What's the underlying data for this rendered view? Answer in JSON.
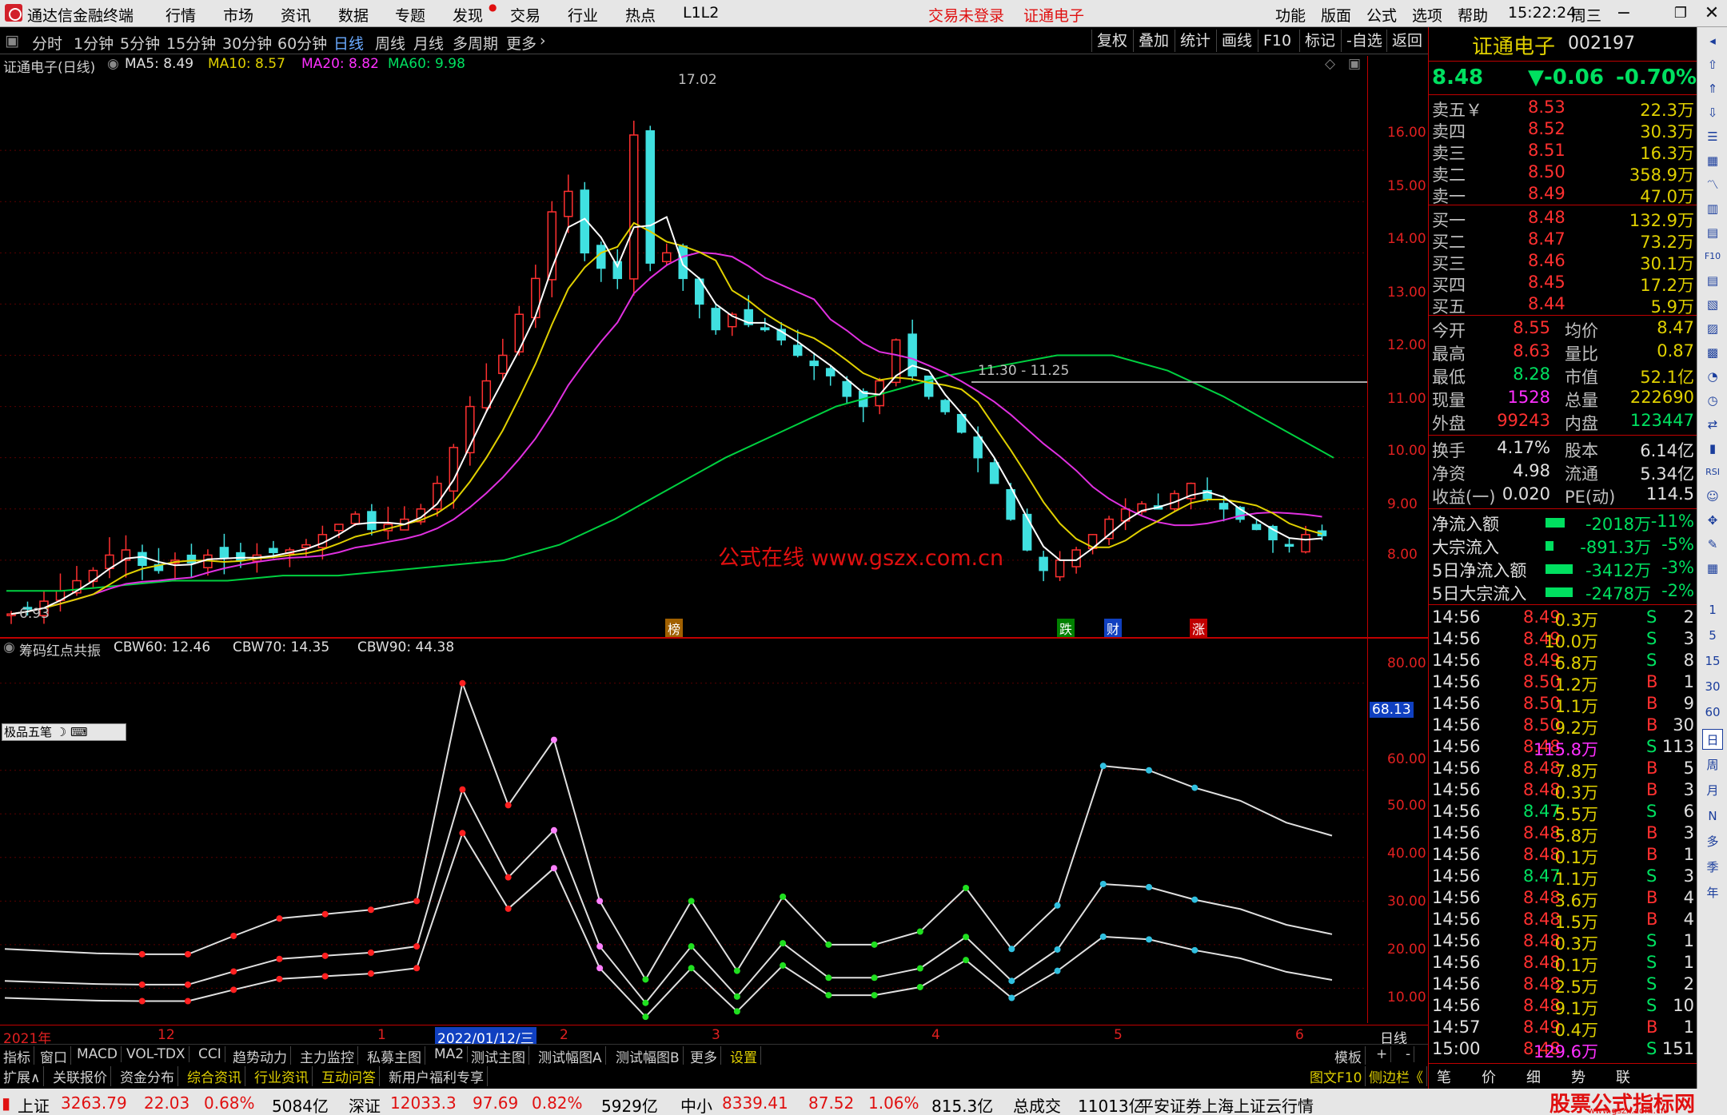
{
  "app": {
    "title": "通达信金融终端",
    "menus": [
      "行情",
      "市场",
      "资讯",
      "数据",
      "专题",
      "发现",
      "交易",
      "行业",
      "热点",
      "L1L2"
    ],
    "trade_status": "交易未登录",
    "stock_name_top": "证通电子",
    "right_menus": [
      "功能",
      "版面",
      "公式",
      "选项",
      "帮助"
    ],
    "time": "15:22:24",
    "weekday": "周三"
  },
  "timeframes": [
    "分时",
    "1分钟",
    "5分钟",
    "15分钟",
    "30分钟",
    "60分钟",
    "日线",
    "周线",
    "月线",
    "多周期",
    "更多"
  ],
  "active_timeframe": "日线",
  "toolbar_btns": [
    "复权",
    "叠加",
    "统计",
    "画线",
    "F10",
    "标记",
    "-自选",
    "返回"
  ],
  "chart_title": {
    "stock": "证通电子(日线)",
    "ma5": "MA5: 8.49",
    "ma10": "MA10: 8.57",
    "ma20": "MA20: 8.82",
    "ma60": "MA60: 9.98"
  },
  "annotations": {
    "high": "17.02",
    "low": "6.93",
    "range": "11.30 - 11.25",
    "watermark": "公式在线 www.gszx.com.cn",
    "event_bang": "榜",
    "event_die": "跌",
    "event_cai": "财",
    "event_zhang": "涨"
  },
  "y_axis_main": [
    "16.00",
    "15.00",
    "14.00",
    "13.00",
    "12.00",
    "11.00",
    "10.00",
    "9.00",
    "8.00"
  ],
  "sub_title": {
    "name": "筹码红点共振",
    "cbw60": "CBW60: 12.46",
    "cbw70": "CBW70: 14.35",
    "cbw90": "CBW90: 44.38"
  },
  "y_axis_sub": [
    "80.00",
    "60.00",
    "50.00",
    "40.00",
    "30.00",
    "20.00",
    "10.00"
  ],
  "sub_marker": "68.13",
  "ime_label": "极品五笔",
  "x_axis": {
    "labels": [
      "2021年",
      "12",
      "1",
      "2022/01/12/三",
      "2",
      "3",
      "4",
      "5",
      "6"
    ],
    "corner": "日线"
  },
  "tabs_row1": [
    "指标",
    "窗口",
    "MACD",
    "VOL-TDX",
    "CCI",
    "趋势动力",
    "主力监控",
    "私募主图",
    "MA2",
    "测试主图",
    "测试幅图A",
    "测试幅图B",
    "更多",
    "设置"
  ],
  "tabs_row1_right": [
    "模板",
    "+",
    "-"
  ],
  "tabs_row2": [
    "扩展∧",
    "关联报价",
    "资金分布",
    "综合资讯",
    "行业资讯",
    "互动问答",
    "新用户福利专享"
  ],
  "tabs_row2_right": [
    "图文F10",
    "侧边栏《"
  ],
  "right_panel": {
    "name": "证通电子",
    "code": "002197",
    "price": "8.48",
    "change": "▼-0.06",
    "pct": "-0.70%",
    "asks": [
      {
        "l": "卖五￥",
        "p": "8.53",
        "v": "22.3万"
      },
      {
        "l": "卖四",
        "p": "8.52",
        "v": "30.3万"
      },
      {
        "l": "卖三",
        "p": "8.51",
        "v": "16.3万"
      },
      {
        "l": "卖二",
        "p": "8.50",
        "v": "358.9万"
      },
      {
        "l": "卖一",
        "p": "8.49",
        "v": "47.0万"
      }
    ],
    "bids": [
      {
        "l": "买一",
        "p": "8.48",
        "v": "132.9万"
      },
      {
        "l": "买二",
        "p": "8.47",
        "v": "73.2万"
      },
      {
        "l": "买三",
        "p": "8.46",
        "v": "30.1万"
      },
      {
        "l": "买四",
        "p": "8.45",
        "v": "17.2万"
      },
      {
        "l": "买五",
        "p": "8.44",
        "v": "5.9万"
      }
    ],
    "stats1": [
      [
        "今开",
        "8.55",
        "均价",
        "8.47"
      ],
      [
        "最高",
        "8.63",
        "量比",
        "0.87"
      ],
      [
        "最低",
        "8.28",
        "市值",
        "52.1亿"
      ],
      [
        "现量",
        "1528",
        "总量",
        "222690"
      ],
      [
        "外盘",
        "99243",
        "内盘",
        "123447"
      ]
    ],
    "stats2": [
      [
        "换手",
        "4.17%",
        "股本",
        "6.14亿"
      ],
      [
        "净资",
        "4.98",
        "流通",
        "5.34亿"
      ],
      [
        "收益(一)",
        "0.020",
        "PE(动)",
        "114.5"
      ]
    ],
    "flows": [
      [
        "净流入额",
        "-2018万",
        "-11%"
      ],
      [
        "大宗流入",
        "-891.3万",
        "-5%"
      ],
      [
        "5日净流入额",
        "-3412万",
        "-3%"
      ],
      [
        "5日大宗流入",
        "-2478万",
        "-2%"
      ]
    ],
    "ticks": [
      [
        "14:56",
        "8.49",
        "0.3万",
        "S",
        "2"
      ],
      [
        "14:56",
        "8.49",
        "10.0万",
        "S",
        "3"
      ],
      [
        "14:56",
        "8.49",
        "6.8万",
        "S",
        "8"
      ],
      [
        "14:56",
        "8.50",
        "1.2万",
        "B",
        "1"
      ],
      [
        "14:56",
        "8.50",
        "1.1万",
        "B",
        "9"
      ],
      [
        "14:56",
        "8.50",
        "9.2万",
        "B",
        "30"
      ],
      [
        "14:56",
        "8.48",
        "115.8万",
        "S",
        "113"
      ],
      [
        "14:56",
        "8.48",
        "7.8万",
        "B",
        "5"
      ],
      [
        "14:56",
        "8.48",
        "0.3万",
        "B",
        "3"
      ],
      [
        "14:56",
        "8.47",
        "5.5万",
        "S",
        "6"
      ],
      [
        "14:56",
        "8.48",
        "5.8万",
        "B",
        "3"
      ],
      [
        "14:56",
        "8.48",
        "0.1万",
        "B",
        "1"
      ],
      [
        "14:56",
        "8.47",
        "1.1万",
        "S",
        "3"
      ],
      [
        "14:56",
        "8.48",
        "3.6万",
        "B",
        "4"
      ],
      [
        "14:56",
        "8.48",
        "1.5万",
        "B",
        "4"
      ],
      [
        "14:56",
        "8.48",
        "0.3万",
        "S",
        "1"
      ],
      [
        "14:56",
        "8.48",
        "0.1万",
        "S",
        "1"
      ],
      [
        "14:56",
        "8.48",
        "2.5万",
        "S",
        "2"
      ],
      [
        "14:56",
        "8.48",
        "9.1万",
        "S",
        "10"
      ],
      [
        "14:57",
        "8.49",
        "0.4万",
        "B",
        "1"
      ],
      [
        "15:00",
        "8.48",
        "129.6万",
        "S",
        "151"
      ]
    ],
    "bottom_tabs": [
      "笔",
      "价",
      "细",
      "势",
      "联"
    ]
  },
  "right_tools": [
    "F10",
    "RSI",
    "1",
    "5",
    "15",
    "30",
    "60",
    "日",
    "周",
    "月",
    "N",
    "多",
    "季",
    "年"
  ],
  "status": {
    "sh_name": "上证",
    "sh_idx": "3263.79",
    "sh_chg": "22.03",
    "sh_pct": "0.68%",
    "sh_amt": "5084亿",
    "sz_name": "深证",
    "sz_idx": "12033.3",
    "sz_chg": "97.69",
    "sz_pct": "0.82%",
    "sz_amt": "5929亿",
    "zx_name": "中小",
    "zx_idx": "8339.41",
    "zx_chg": "87.52",
    "zx_pct": "1.06%",
    "zx_amt": "815.3亿",
    "total_name": "总成交",
    "total_amt": "11013亿",
    "broker": "平安证券上海上证云行情",
    "brand": "股票公式指标网",
    "brand_url": "www.gszx.com.cn"
  },
  "chart_data": {
    "type": "candlestick",
    "y_range": [
      6.5,
      17.5
    ],
    "close_points": [
      6.95,
      7.05,
      7.2,
      7.4,
      7.6,
      7.8,
      8.1,
      8.2,
      7.9,
      7.8,
      8.0,
      7.95,
      8.1,
      8.05,
      8.0,
      8.1,
      8.15,
      8.2,
      8.3,
      8.5,
      8.7,
      8.9,
      8.6,
      8.7,
      8.8,
      9.0,
      9.5,
      10.2,
      11.0,
      11.5,
      12.0,
      12.8,
      13.5,
      14.8,
      15.2,
      14.0,
      13.7,
      13.5,
      16.3,
      13.8,
      14.0,
      13.5,
      13.0,
      12.5,
      12.8,
      12.6,
      12.5,
      12.3,
      12.0,
      11.8,
      11.6,
      11.2,
      11.0,
      11.5,
      12.3,
      11.6,
      11.2,
      10.9,
      10.5,
      10.0,
      9.5,
      8.8,
      8.2,
      7.8,
      8.0,
      8.2,
      8.5,
      8.8,
      9.0,
      9.1,
      9.0,
      9.3,
      9.5,
      9.2,
      9.0,
      8.8,
      8.6,
      8.4,
      8.3,
      8.5,
      8.48
    ],
    "ma60": [
      7.4,
      7.4,
      7.5,
      7.6,
      7.6,
      7.7,
      7.7,
      7.8,
      7.9,
      8.0,
      8.3,
      8.8,
      9.4,
      10.0,
      10.5,
      11.0,
      11.3,
      11.6,
      11.8,
      12.0,
      12.0,
      11.7,
      11.2,
      10.6,
      10.0
    ],
    "cbw90": [
      19,
      18.5,
      18,
      17.8,
      17.8,
      22,
      26,
      27,
      28,
      30,
      80,
      52,
      67,
      30,
      12,
      30,
      14,
      31,
      20,
      20,
      23,
      33,
      19,
      29,
      61,
      60,
      56,
      53,
      48,
      45
    ]
  }
}
